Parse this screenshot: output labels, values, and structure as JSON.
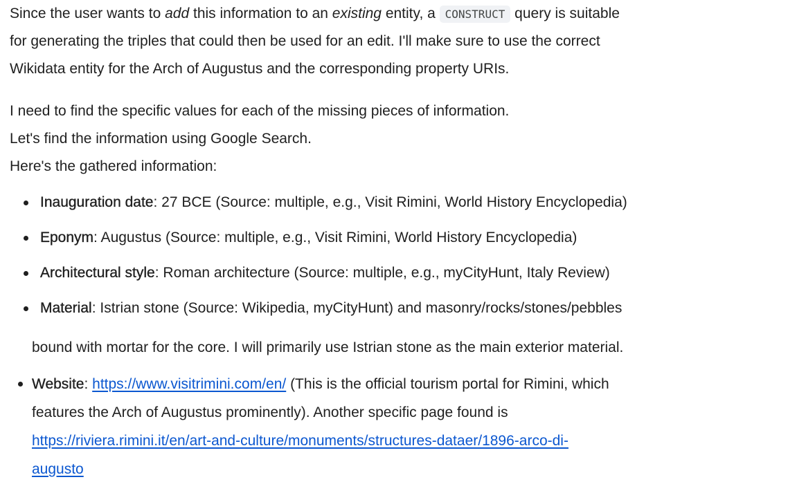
{
  "para1": {
    "l1_a": "Since the user wants to ",
    "l1_em1": "add",
    "l1_b": " this information to an ",
    "l1_em2": "existing",
    "l1_c": " entity, a ",
    "l1_code": "CONSTRUCT",
    "l1_d": " query is suitable",
    "l2": "for generating the triples that could then be used for an edit. I'll make sure to use the correct",
    "l3": "Wikidata entity for the Arch of Augustus and the corresponding property URIs."
  },
  "para2": {
    "l1": "I need to find the specific values for each of the missing pieces of information.",
    "l2": "Let's find the information using Google Search.",
    "l3": "Here's the gathered information:"
  },
  "facts": [
    {
      "term": "Inauguration date",
      "text": ": 27 BCE (Source: multiple, e.g., Visit Rimini, World History Encyclopedia)"
    },
    {
      "term": "Eponym",
      "text": ": Augustus (Source: multiple, e.g., Visit Rimini, World History Encyclopedia)"
    },
    {
      "term": "Architectural style",
      "text": ": Roman architecture (Source: multiple, e.g., myCityHunt, Italy Review)"
    },
    {
      "term": "Material",
      "text": ": Istrian stone (Source: Wikipedia, myCityHunt) and masonry/rocks/stones/pebbles"
    }
  ],
  "material_continuation": "bound with mortar for the core. I will primarily use Istrian stone as the main exterior material.",
  "website": {
    "term": "Website",
    "sep": ": ",
    "link1": "https://www.visitrimini.com/en/",
    "after_link1": " (This is the official tourism portal for Rimini, which",
    "l2": "features the Arch of Augustus prominently). Another specific page found is",
    "link2_l1": "https://riviera.rimini.it/en/art-and-culture/monuments/structures-dataer/1896-arco-di-",
    "link2_l2": "augusto"
  }
}
